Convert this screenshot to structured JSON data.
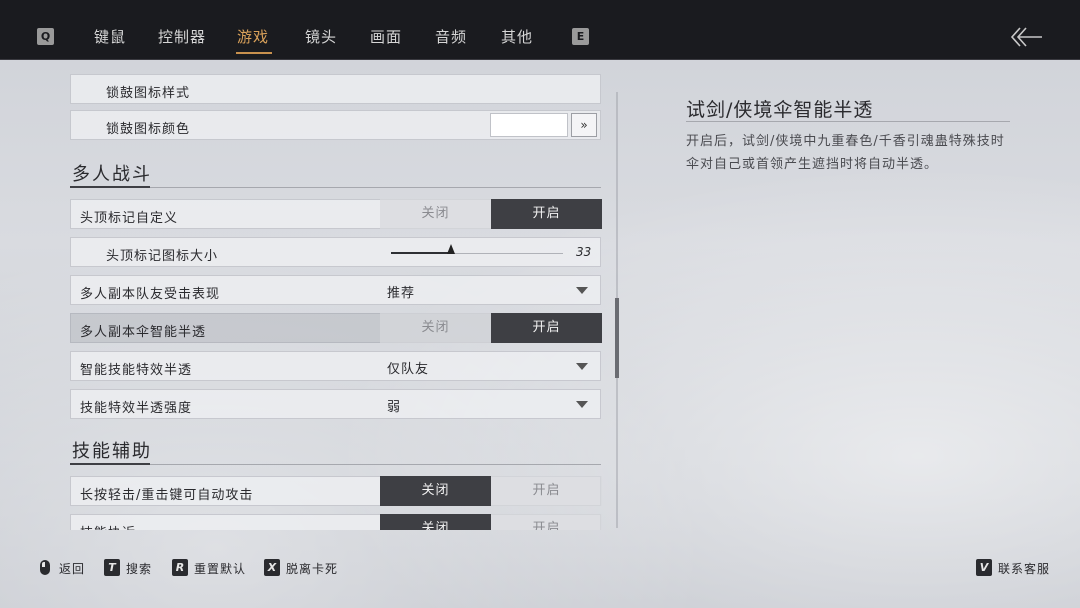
{
  "nav": {
    "left_key": "Q",
    "right_key": "E",
    "tabs": [
      {
        "label": "键鼠"
      },
      {
        "label": "控制器"
      },
      {
        "label": "游戏"
      },
      {
        "label": "镜头"
      },
      {
        "label": "画面"
      },
      {
        "label": "音频"
      },
      {
        "label": "其他"
      }
    ],
    "active_tab": "游戏"
  },
  "settings": {
    "partial_row_label": "锁鼓图标样式",
    "lock_icon_color": {
      "label": "锁鼓图标颜色",
      "value": "#ffffff",
      "button": "»"
    },
    "sections": [
      {
        "title": "多人战斗"
      },
      {
        "title": "技能辅助"
      }
    ],
    "rows": [
      {
        "label": "头顶标记自定义",
        "off": "关闭",
        "on": "开启",
        "selected": "开启"
      },
      {
        "label": "头顶标记图标大小",
        "value": "33",
        "fraction": 0.35
      },
      {
        "label": "多人副本队友受击表现",
        "value": "推荐"
      },
      {
        "label": "多人副本伞智能半透",
        "off": "关闭",
        "on": "开启",
        "selected": "开启"
      },
      {
        "label": "智能技能特效半透",
        "value": "仅队友"
      },
      {
        "label": "技能特效半透强度",
        "value": "弱"
      },
      {
        "label": "长按轻击/重击键可自动攻击",
        "off": "关闭",
        "on": "开启",
        "selected": "关闭"
      },
      {
        "label": "技能协近",
        "off": "关闭",
        "on": "开启",
        "selected": "关闭"
      }
    ]
  },
  "detail": {
    "title": "试剑/侠境伞智能半透",
    "description": "开启后，试剑/侠境中九重春色/千香引魂蛊特殊技时伞对自己或首领产生遮挡时将自动半透。"
  },
  "footer": {
    "hints": [
      {
        "key": "",
        "icon": "mouse-icon",
        "label": "返回"
      },
      {
        "key": "T",
        "label": "搜索"
      },
      {
        "key": "R",
        "label": "重置默认"
      },
      {
        "key": "X",
        "label": "脱离卡死"
      },
      {
        "key": "V",
        "label": "联系客服"
      }
    ]
  },
  "colors": {
    "topbar": "#1a1b1f",
    "active_tab": "#d9a15a",
    "toggle_selected": "#3e3f44"
  }
}
